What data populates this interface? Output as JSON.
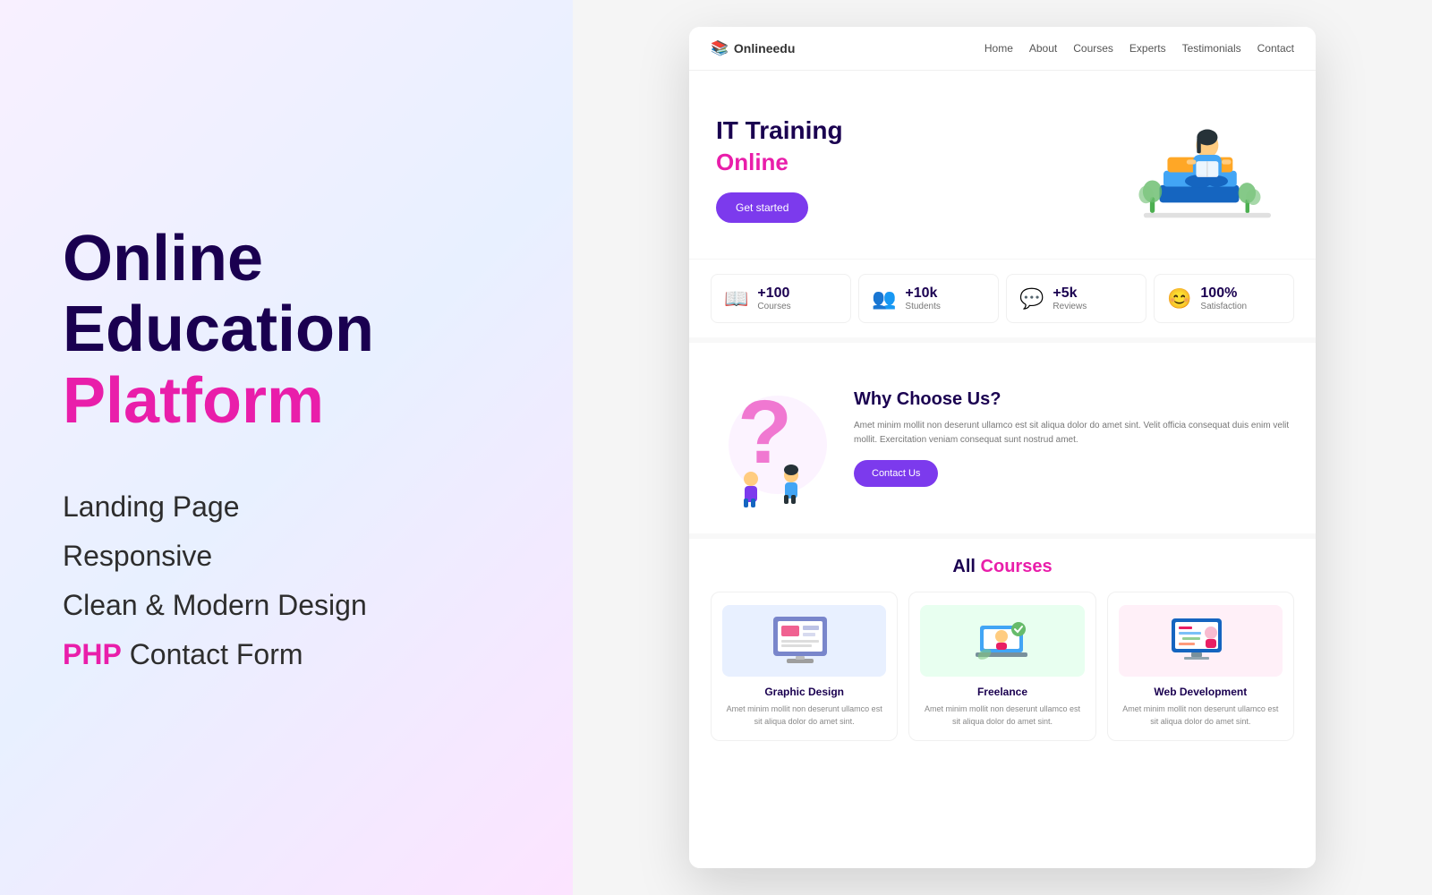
{
  "left": {
    "title_line1": "Online",
    "title_line2": "Education",
    "title_line3": "Platform",
    "features": [
      {
        "text": "Landing Page",
        "highlight": false
      },
      {
        "text": "Responsive",
        "highlight": false
      },
      {
        "text": "Clean & Modern Design",
        "highlight": false
      },
      {
        "text_before": "",
        "php": "PHP",
        "text_after": " Contact Form",
        "highlight": true
      }
    ]
  },
  "site": {
    "logo": "Onlineedu",
    "nav": [
      "Home",
      "About",
      "Courses",
      "Experts",
      "Testimonials",
      "Contact"
    ],
    "hero": {
      "line1": "IT Training",
      "line2": "Online",
      "cta": "Get started"
    },
    "stats": [
      {
        "number": "+100",
        "label": "Courses",
        "icon": "📖"
      },
      {
        "number": "+10k",
        "label": "Students",
        "icon": "👥"
      },
      {
        "number": "+5k",
        "label": "Reviews",
        "icon": "💬"
      },
      {
        "number": "100%",
        "label": "Satisfaction",
        "icon": "😊"
      }
    ],
    "why": {
      "title": "Why Choose Us?",
      "description": "Amet minim mollit non deserunt ullamco est sit aliqua dolor do amet sint. Velit officia consequat duis enim velit mollit. Exercitation veniam consequat sunt nostrud amet.",
      "cta": "Contact Us"
    },
    "courses": {
      "title_all": "All",
      "title_courses": "Courses",
      "items": [
        {
          "name": "Graphic Design",
          "desc": "Amet minim mollit non deserunt ullamco est sit aliqua dolor do amet sint.",
          "color": "#e8f0ff"
        },
        {
          "name": "Freelance",
          "desc": "Amet minim mollit non deserunt ullamco est sit aliqua dolor do amet sint.",
          "color": "#f0fff0"
        },
        {
          "name": "Web Development",
          "desc": "Amet minim mollit non deserunt ullamco est sit aliqua dolor do amet sint.",
          "color": "#fff0f8"
        }
      ]
    }
  }
}
